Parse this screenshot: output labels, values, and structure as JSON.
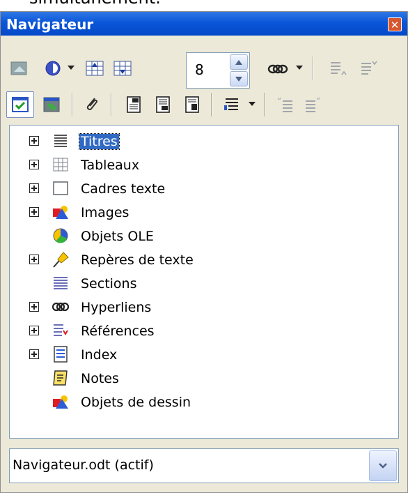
{
  "caption_fragment": "simultanément.",
  "window": {
    "title": "Navigateur",
    "close_glyph": "✕"
  },
  "toolbar": {
    "row1": {
      "items": [
        "toggle-icon",
        "navigation-icon",
        "dropdown-arrow",
        "previous-icon",
        "next-icon",
        "spinbox",
        "drag-mode-icon",
        "dropdown-arrow",
        "promote-level-icon",
        "demote-level-icon"
      ]
    },
    "row2": {
      "items": [
        "content-view-icon",
        "update-icon",
        "edit-icon",
        "header-icon",
        "footer-icon",
        "anchor-icon",
        "heading-levels-icon",
        "dropdown-arrow",
        "promote-chapter-icon",
        "demote-chapter-icon"
      ]
    },
    "spin_value": "8"
  },
  "tree": {
    "items": [
      {
        "label": "Titres",
        "icon": "headings-icon",
        "expandable": true,
        "selected": true
      },
      {
        "label": "Tableaux",
        "icon": "table-icon",
        "expandable": true,
        "selected": false
      },
      {
        "label": "Cadres texte",
        "icon": "text-frame-icon",
        "expandable": true,
        "selected": false
      },
      {
        "label": "Images",
        "icon": "image-icon",
        "expandable": true,
        "selected": false
      },
      {
        "label": "Objets OLE",
        "icon": "ole-object-icon",
        "expandable": false,
        "selected": false
      },
      {
        "label": "Repères de texte",
        "icon": "bookmark-pin-icon",
        "expandable": true,
        "selected": false
      },
      {
        "label": "Sections",
        "icon": "sections-icon",
        "expandable": false,
        "selected": false
      },
      {
        "label": "Hyperliens",
        "icon": "hyperlink-icon",
        "expandable": true,
        "selected": false
      },
      {
        "label": "Références",
        "icon": "references-icon",
        "expandable": true,
        "selected": false
      },
      {
        "label": "Index",
        "icon": "index-icon",
        "expandable": true,
        "selected": false
      },
      {
        "label": "Notes",
        "icon": "note-icon",
        "expandable": false,
        "selected": false
      },
      {
        "label": "Objets de dessin",
        "icon": "drawing-object-icon",
        "expandable": false,
        "selected": false
      }
    ]
  },
  "document_select": {
    "value": "Navigateur.odt (actif)"
  }
}
